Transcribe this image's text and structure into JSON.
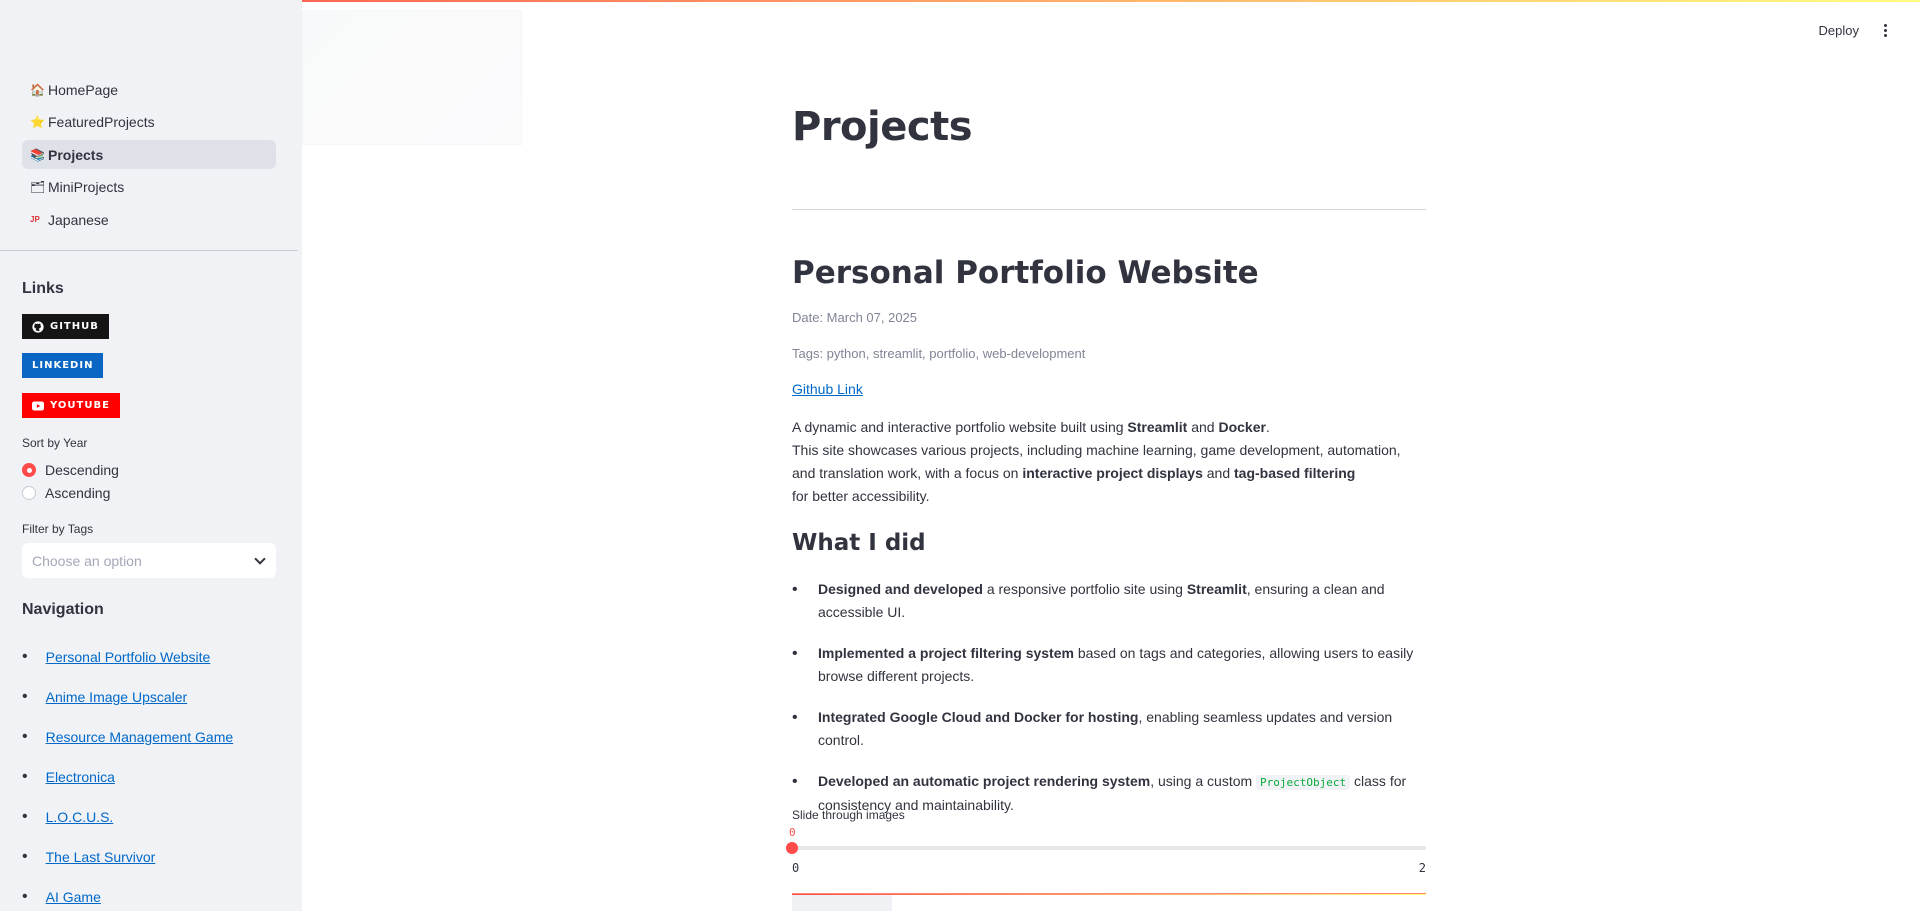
{
  "header": {
    "deploy_label": "Deploy",
    "menu_icon": "kebab-menu-icon"
  },
  "sidebar": {
    "pages": [
      {
        "label": "HomePage",
        "icon": "house-icon",
        "glyph": "🏠"
      },
      {
        "label": "FeaturedProjects",
        "icon": "star-icon",
        "glyph": "⭐"
      },
      {
        "label": "Projects",
        "icon": "books-icon",
        "glyph": "📚",
        "active": true
      },
      {
        "label": "MiniProjects",
        "icon": "folder-icon",
        "glyph": "🗂"
      },
      {
        "label": "Japanese",
        "icon": "jp-flag-icon",
        "glyph": "JP"
      }
    ],
    "links_heading": "Links",
    "badges": [
      {
        "label": "GITHUB",
        "color": "#151515",
        "icon": "github-icon"
      },
      {
        "label": "LINKEDIN",
        "color": "#0a66c2",
        "icon": ""
      },
      {
        "label": "YOUTUBE",
        "color": "#ff0000",
        "icon": "youtube-icon"
      }
    ],
    "sort_label": "Sort by Year",
    "sort_options": [
      {
        "label": "Descending",
        "selected": true
      },
      {
        "label": "Ascending",
        "selected": false
      }
    ],
    "filter_label": "Filter by Tags",
    "filter_placeholder": "Choose an option",
    "navigation_heading": "Navigation",
    "navigation_links": [
      "Personal Portfolio Website",
      "Anime Image Upscaler",
      "Resource Management Game",
      "Electronica",
      "L.O.C.U.S.",
      "The Last Survivor",
      "AI Game"
    ]
  },
  "main": {
    "page_title": "Projects",
    "project": {
      "title": "Personal Portfolio Website",
      "date": "Date: March 07, 2025",
      "tags": "Tags: python, streamlit, portfolio, web-development",
      "github_link": "Github Link",
      "description": {
        "l1_a": "A dynamic and interactive portfolio website built using ",
        "l1_b": "Streamlit",
        "l1_c": " and ",
        "l1_d": "Docker",
        "l1_e": ".",
        "l2": "This site showcases various projects, including machine learning, game development, automation,",
        "l3_a": "and translation work, with a focus on ",
        "l3_b": "interactive project displays",
        "l3_c": " and ",
        "l3_d": "tag-based filtering",
        "l4": "for better accessibility."
      },
      "section_heading": "What I did",
      "bullets": [
        {
          "bold": "Designed and developed",
          "text": " a responsive portfolio site using ",
          "bold2": "Streamlit",
          "text2": ", ensuring a clean and accessible UI."
        },
        {
          "bold": "Implemented a project filtering system",
          "text": " based on tags and categories, allowing users to easily browse different projects."
        },
        {
          "bold": "Integrated Google Cloud and Docker for hosting",
          "text": ", enabling seamless updates and version control."
        },
        {
          "bold": "Developed an automatic project rendering system",
          "text": ", using a custom ",
          "code": "ProjectObject",
          "text2": " class for consistency and maintainability."
        }
      ],
      "slider": {
        "label": "Slide through images",
        "value": 0,
        "min": 0,
        "max": 2
      }
    }
  },
  "colors": {
    "accent": "#ff4b4b",
    "link": "#0068c9",
    "sidebar_bg": "#f0f2f6"
  }
}
